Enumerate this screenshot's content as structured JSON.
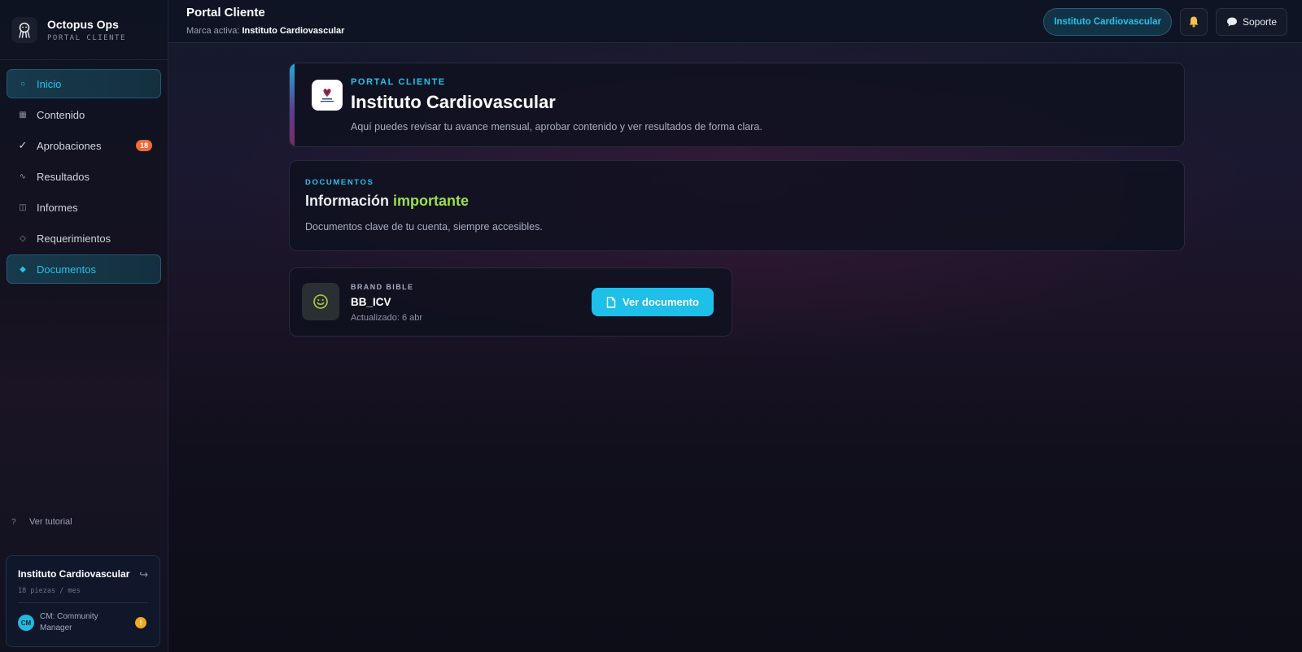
{
  "brand": {
    "name": "Octopus Ops",
    "tagline": "PORTAL CLIENTE",
    "icon": "octopus-logo-icon"
  },
  "sidebar": {
    "items": [
      {
        "label": "Inicio",
        "icon": "circle-icon",
        "glyph": "○",
        "active": true
      },
      {
        "label": "Contenido",
        "icon": "grid-icon",
        "glyph": "▦",
        "active": false
      },
      {
        "label": "Aprobaciones",
        "icon": "check-icon",
        "glyph": "✓",
        "active": false,
        "badge": "18"
      },
      {
        "label": "Resultados",
        "icon": "trend-icon",
        "glyph": "∿",
        "active": false
      },
      {
        "label": "Informes",
        "icon": "report-icon",
        "glyph": "◫",
        "active": false
      },
      {
        "label": "Requerimientos",
        "icon": "diamond-outline-icon",
        "glyph": "◇",
        "active": false
      },
      {
        "label": "Documentos",
        "icon": "diamond-icon",
        "glyph": "◆",
        "active": true
      }
    ],
    "tutorial": {
      "label": "Ver tutorial",
      "glyph": "?"
    },
    "account": {
      "name": "Instituto Cardiovascular",
      "meta": "18 piezas / mes",
      "exit_glyph": "↪",
      "avatar": "CM",
      "role": "CM: Community Manager",
      "warning": "!"
    }
  },
  "topbar": {
    "title": "Portal Cliente",
    "sub_label": "Marca activa:",
    "sub_value": "Instituto Cardiovascular",
    "brand_pill": "Instituto Cardiovascular",
    "support_label": "Soporte"
  },
  "hero": {
    "eyebrow": "PORTAL CLIENTE",
    "title": "Instituto Cardiovascular",
    "description": "Aquí puedes revisar tu avance mensual, aprobar contenido y ver resultados de forma clara."
  },
  "documents": {
    "eyebrow": "DOCUMENTOS",
    "title_plain": "Información",
    "title_highlight": "importante",
    "description": "Documentos clave de tu cuenta, siempre accesibles.",
    "items": [
      {
        "kind": "BRAND BIBLE",
        "name": "BB_ICV",
        "updated": "Actualizado: 6 abr",
        "button_label": "Ver documento"
      }
    ]
  },
  "colors": {
    "accent": "#22c3ee",
    "highlight": "#9be04a",
    "badge": "#f06a3a",
    "warning": "#f2a81d"
  }
}
